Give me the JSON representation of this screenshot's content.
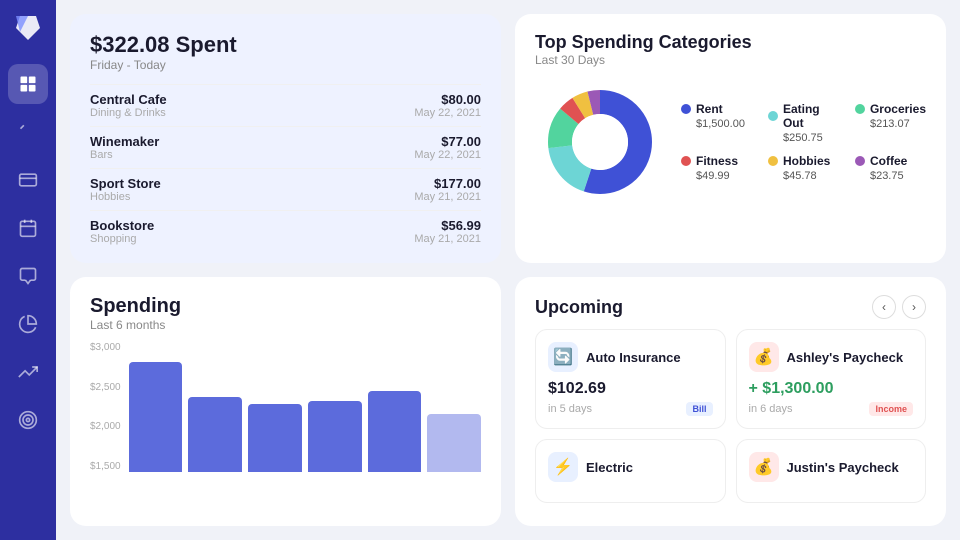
{
  "sidebar": {
    "logo_color": "#5c6ef8",
    "items": [
      {
        "name": "dashboard",
        "icon": "grid",
        "active": true
      },
      {
        "name": "transfer",
        "icon": "arrows",
        "active": false
      },
      {
        "name": "cards",
        "icon": "cards",
        "active": false
      },
      {
        "name": "calendar",
        "icon": "calendar",
        "active": false
      },
      {
        "name": "reports",
        "icon": "reports",
        "active": false
      },
      {
        "name": "chart",
        "icon": "pie",
        "active": false
      },
      {
        "name": "trends",
        "icon": "trending",
        "active": false
      },
      {
        "name": "goals",
        "icon": "goals",
        "active": false
      }
    ]
  },
  "spent_card": {
    "title": "$322.08 Spent",
    "subtitle": "Friday - Today",
    "transactions": [
      {
        "name": "Central Cafe",
        "category": "Dining & Drinks",
        "amount": "$80.00",
        "date": "May 22, 2021"
      },
      {
        "name": "Winemaker",
        "category": "Bars",
        "amount": "$77.00",
        "date": "May 22, 2021"
      },
      {
        "name": "Sport Store",
        "category": "Hobbies",
        "amount": "$177.00",
        "date": "May 21, 2021"
      },
      {
        "name": "Bookstore",
        "category": "Shopping",
        "amount": "$56.99",
        "date": "May 21, 2021"
      }
    ]
  },
  "categories_card": {
    "title": "Top Spending Categories",
    "subtitle": "Last 30 Days",
    "legend": [
      {
        "label": "Rent",
        "value": "$1,500.00",
        "color": "#3f51d6"
      },
      {
        "label": "Eating Out",
        "value": "$250.75",
        "color": "#6dd5d5"
      },
      {
        "label": "Groceries",
        "value": "$213.07",
        "color": "#52d49e"
      },
      {
        "label": "Fitness",
        "value": "$49.99",
        "color": "#e05252"
      },
      {
        "label": "Hobbies",
        "value": "$45.78",
        "color": "#f0c040"
      },
      {
        "label": "Coffee",
        "value": "$23.75",
        "color": "#9b59b6"
      }
    ],
    "donut_segments": [
      {
        "color": "#3f51d6",
        "pct": 55
      },
      {
        "color": "#6dd5d5",
        "pct": 18
      },
      {
        "color": "#52d49e",
        "pct": 13
      },
      {
        "color": "#e05252",
        "pct": 5
      },
      {
        "color": "#f0c040",
        "pct": 5
      },
      {
        "color": "#9b59b6",
        "pct": 4
      }
    ]
  },
  "spending_card": {
    "title": "Spending",
    "subtitle": "Last 6 months",
    "y_labels": [
      "$3,000",
      "$2,500",
      "$2,000",
      "$1,500"
    ],
    "bars": [
      {
        "height_pct": 85,
        "faded": false
      },
      {
        "height_pct": 58,
        "faded": false
      },
      {
        "height_pct": 52,
        "faded": false
      },
      {
        "height_pct": 55,
        "faded": false
      },
      {
        "height_pct": 62,
        "faded": false
      },
      {
        "height_pct": 45,
        "faded": true
      }
    ]
  },
  "upcoming_card": {
    "title": "Upcoming",
    "nav_prev": "‹",
    "nav_next": "›",
    "items": [
      {
        "name": "Auto Insurance",
        "icon": "🔄",
        "icon_bg": "#e8f0ff",
        "amount": "$102.69",
        "amount_positive": false,
        "days": "in 5 days",
        "badge": "Bill",
        "badge_type": "bill"
      },
      {
        "name": "Ashley's Paycheck",
        "icon": "💰",
        "icon_bg": "#ffe8e8",
        "amount": "+ $1,300.00",
        "amount_positive": true,
        "days": "in 6 days",
        "badge": "Income",
        "badge_type": "income"
      },
      {
        "name": "Electric",
        "icon": "⚡",
        "icon_bg": "#e8f0ff",
        "amount": "",
        "amount_positive": false,
        "days": "",
        "badge": "",
        "badge_type": ""
      },
      {
        "name": "Justin's Paycheck",
        "icon": "💰",
        "icon_bg": "#ffe8e8",
        "amount": "",
        "amount_positive": false,
        "days": "",
        "badge": "",
        "badge_type": ""
      }
    ]
  }
}
